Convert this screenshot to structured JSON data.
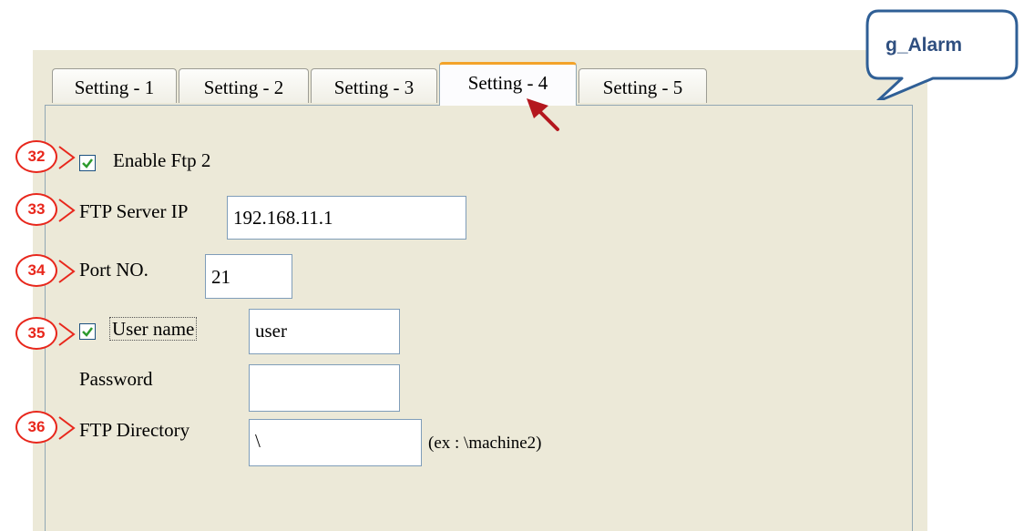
{
  "callout": {
    "text": "g_Alarm"
  },
  "tabs": [
    {
      "label": "Setting - 1"
    },
    {
      "label": "Setting - 2"
    },
    {
      "label": "Setting - 3"
    },
    {
      "label": "Setting - 4",
      "active": true
    },
    {
      "label": "Setting - 5"
    }
  ],
  "form": {
    "enable_ftp": {
      "label": "Enable Ftp 2",
      "checked": true
    },
    "server_ip": {
      "label": "FTP Server IP",
      "value": "192.168.11.1"
    },
    "port": {
      "label": "Port NO.",
      "value": "21"
    },
    "username": {
      "label": "User name",
      "checked": true,
      "value": "user"
    },
    "password": {
      "label": "Password",
      "value": ""
    },
    "directory": {
      "label": "FTP Directory",
      "value": "\\",
      "hint": "(ex : \\machine2)"
    }
  },
  "annotations": [
    {
      "number": "32"
    },
    {
      "number": "33"
    },
    {
      "number": "34"
    },
    {
      "number": "35"
    },
    {
      "number": "36"
    }
  ],
  "colors": {
    "panel": "#ece9d8",
    "active_tab_accent": "#f3a32a",
    "annotation_red": "#e8271c",
    "arrow": "#b4171e",
    "callout_border": "#2f5f96",
    "checkmark": "#2d9a2d"
  }
}
